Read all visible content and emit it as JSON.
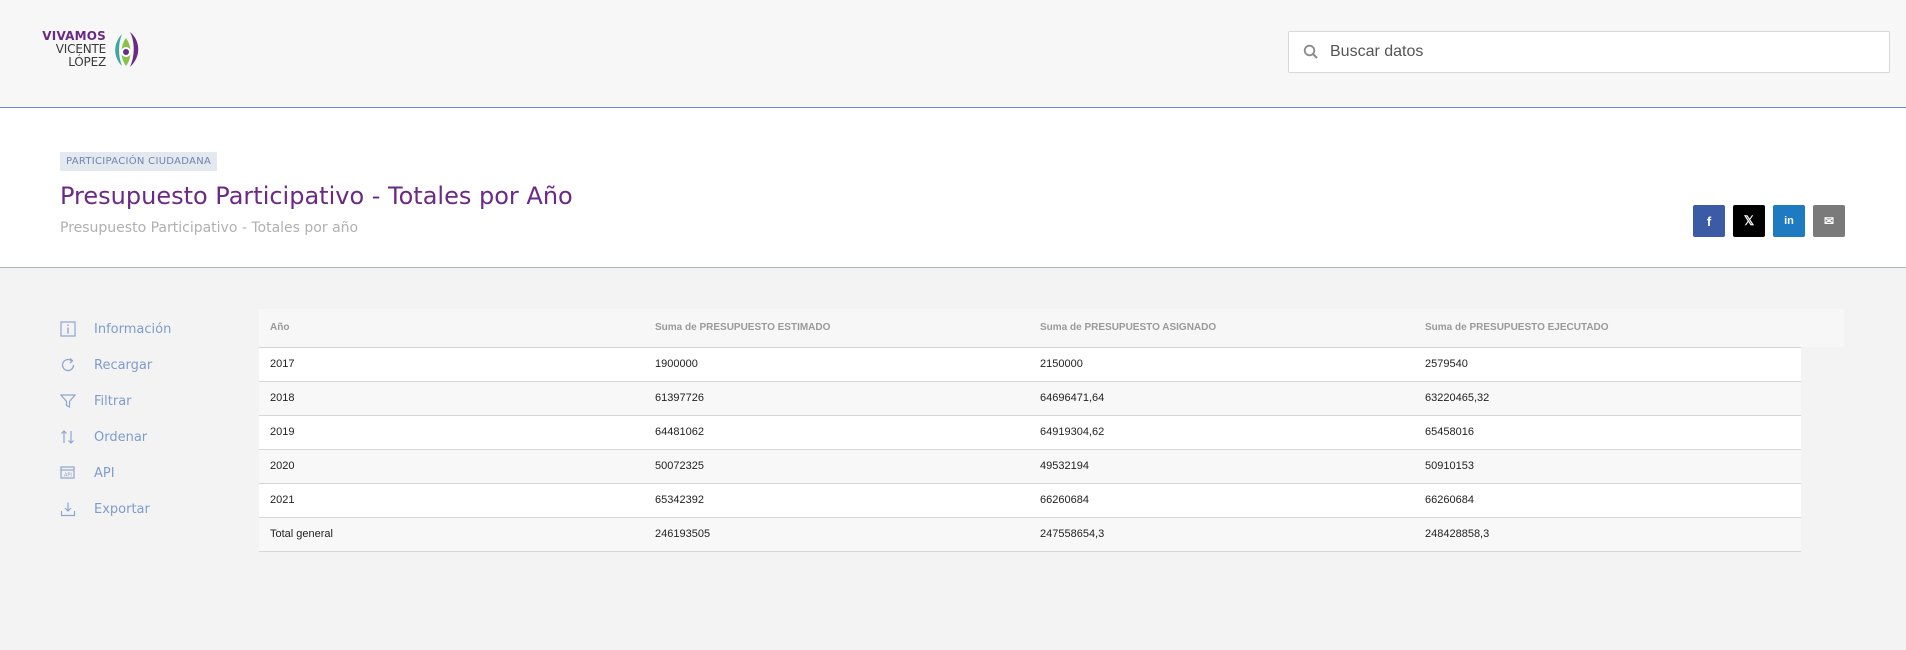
{
  "header": {
    "logo": {
      "line1": "VIVAMOS",
      "line2": "VICENTE LÓPEZ"
    },
    "search": {
      "placeholder": "Buscar datos",
      "value": ""
    }
  },
  "dataset": {
    "category": "PARTICIPACIÓN CIUDADANA",
    "title": "Presupuesto Participativo - Totales por Año",
    "subtitle": "Presupuesto Participativo - Totales por año"
  },
  "share": {
    "facebook": "f",
    "x": "𝕏",
    "linkedin": "in",
    "email": "✉"
  },
  "sidebar": {
    "items": [
      {
        "label": "Información",
        "icon": "info-icon"
      },
      {
        "label": "Recargar",
        "icon": "reload-icon"
      },
      {
        "label": "Filtrar",
        "icon": "filter-icon"
      },
      {
        "label": "Ordenar",
        "icon": "sort-icon"
      },
      {
        "label": "API",
        "icon": "api-icon"
      },
      {
        "label": "Exportar",
        "icon": "download-icon"
      }
    ]
  },
  "table": {
    "headers": [
      "Año",
      "Suma de PRESUPUESTO ESTIMADO",
      "Suma de PRESUPUESTO ASIGNADO",
      "Suma de PRESUPUESTO EJECUTADO"
    ],
    "rows": [
      [
        "2017",
        "1900000",
        "2150000",
        "2579540"
      ],
      [
        "2018",
        "61397726",
        "64696471,64",
        "63220465,32"
      ],
      [
        "2019",
        "64481062",
        "64919304,62",
        "65458016"
      ],
      [
        "2020",
        "50072325",
        "49532194",
        "50910153"
      ],
      [
        "2021",
        "65342392",
        "66260684",
        "66260684"
      ],
      [
        "Total general",
        "246193505",
        "247558654,3",
        "248428858,3"
      ]
    ]
  },
  "colors": {
    "brand_purple": "#6b2a86",
    "link_blue": "#7f9ccc",
    "facebook": "#3b5ba5",
    "x": "#000000",
    "linkedin": "#1f7bc1",
    "email": "#7a7a7a"
  }
}
